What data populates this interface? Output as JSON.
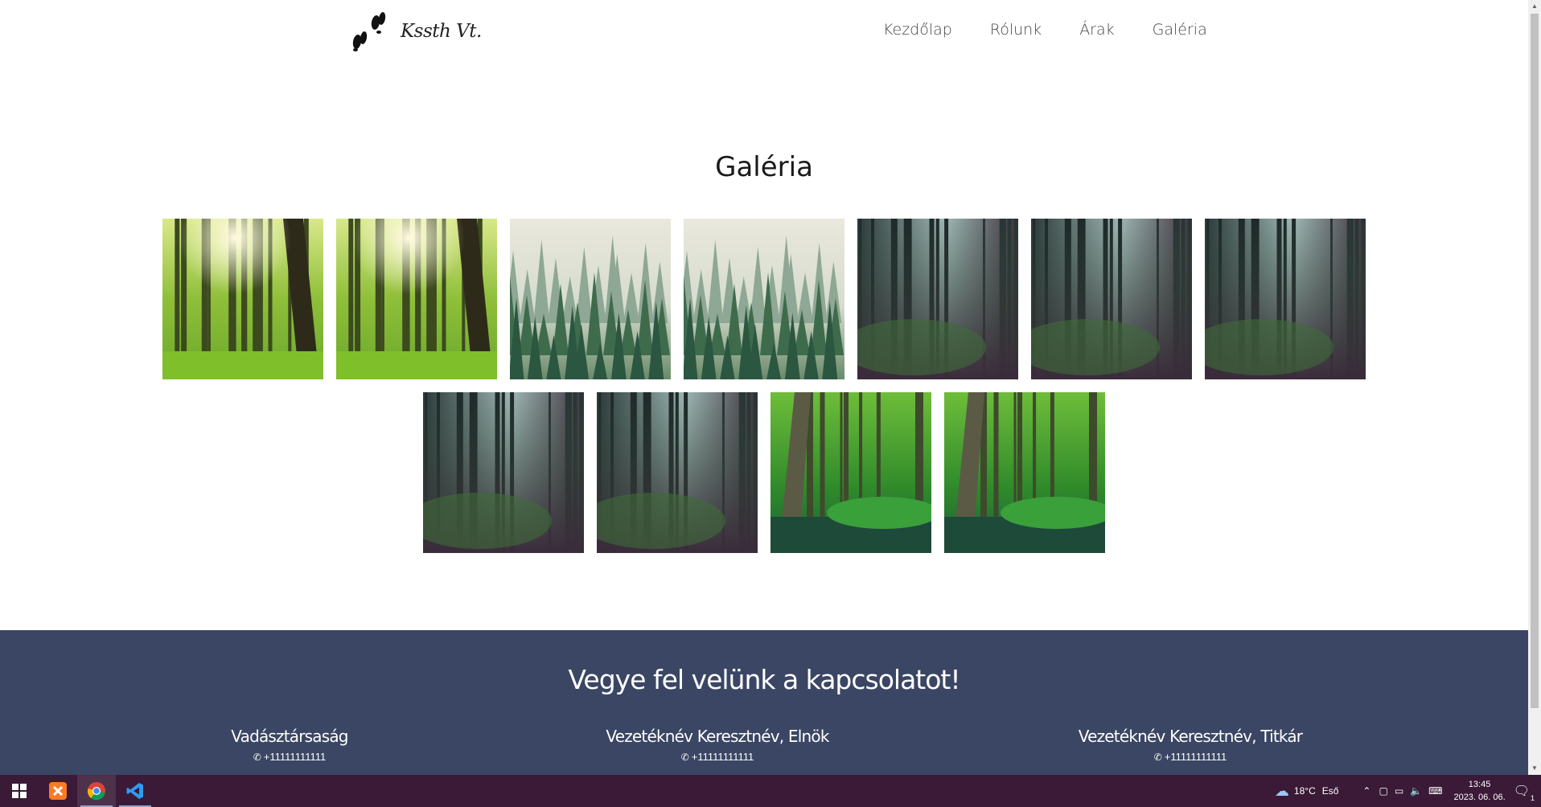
{
  "header": {
    "logo_text": "Kssth Vt.",
    "nav": [
      "Kezdőlap",
      "Rólunk",
      "Árak",
      "Galéria"
    ]
  },
  "gallery": {
    "title": "Galéria",
    "images_row1": [
      "sunny-forest",
      "sunny-forest",
      "foggy-pines",
      "foggy-pines",
      "misty-dark-forest",
      "misty-dark-forest",
      "misty-dark-forest"
    ],
    "images_row2": [
      "misty-dark-forest",
      "misty-dark-forest",
      "green-river-forest",
      "green-river-forest"
    ]
  },
  "contact": {
    "title": "Vegye fel velünk a kapcsolatot!",
    "people": [
      {
        "name": "Vadásztársaság",
        "phone": "+11111111111"
      },
      {
        "name": "Vezetéknév Keresztnév, Elnök",
        "phone": "+11111111111"
      },
      {
        "name": "Vezetéknév Keresztnév, Titkár",
        "phone": "+11111111111"
      }
    ],
    "background": "#3a4663"
  },
  "taskbar": {
    "background": "#3a1a37",
    "apps": [
      "windows-start-icon",
      "xampp-icon",
      "chrome-icon",
      "vscode-icon"
    ],
    "weather_temp": "18°C",
    "weather_text": "Eső",
    "time": "13:45",
    "date": "2023. 06. 06.",
    "notification_count": "1"
  }
}
